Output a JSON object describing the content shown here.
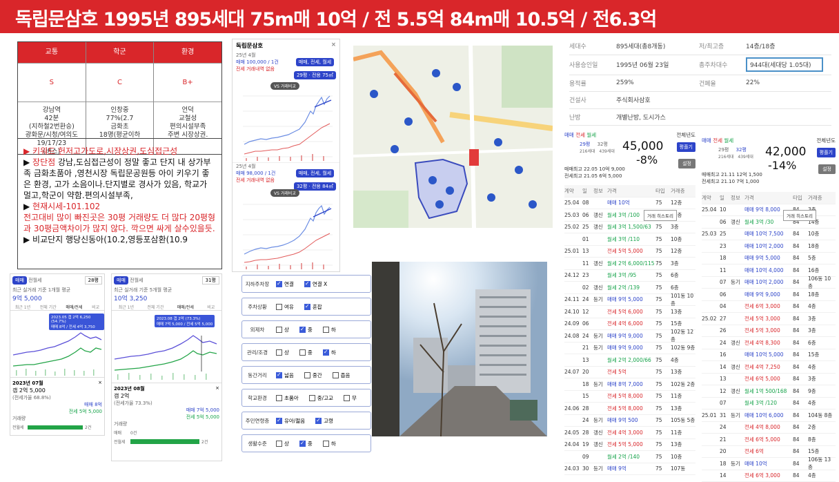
{
  "banner": {
    "title": "독립문삼호 1995년 895세대 75m매 10억 / 전 5.5억 84m매 10.5억 / 전6.3억"
  },
  "grade": {
    "headers": [
      "교통",
      "학군",
      "환경"
    ],
    "levels": [
      "S",
      "C",
      "B+"
    ],
    "details": [
      "강남역\n42분\n(지하철2번환승)\n광화문/시청/여의도\n19/17/23\n(버스)",
      "인창중\n77%(2.7\n금화초\n18명(평균이하",
      "언덕\n교철성\n편의시설부족\n주변 시장상권."
    ]
  },
  "note": {
    "l1": "▶ 키워드 헌저고가도로,시장상권,도심접근성",
    "l2a": "▶ ",
    "l2b": "장단점",
    "l2c": " 강남,도심접근성이 정말 좋고 단지 내 상가부족 금화초품아 ,영천시장 독립문공원등 아이 키우기 좋은 환경, 고가 소음이나.단지별로 경사가 있음, 학교가 멀고,학군이 약함.편의시설부족,",
    "l3a": "▶ ",
    "l3b": "현재시세-101.102",
    "l4": "전고대비 많이 빠진곳은 30평 거래량도 더 많다 20평형과 30평금액차이가 많지 않다. 깍으면 싸게 살수있을듯.",
    "l5": "▶ 비교단지 행당신동아(10.2,영등포삼환(10.9"
  },
  "chartcard": {
    "title": "독립문삼호",
    "close": "×",
    "top": {
      "date": "25년 4월",
      "price": "매매 100,000 / 1건",
      "sub": "전세 거래내역 없음",
      "chip": "매매, 전세, 월세",
      "chip2": "29평 · 전용 75㎡",
      "vs": "VS 거래비교"
    },
    "bottom": {
      "date": "25년 4월",
      "price": "매매 98,000 / 1건",
      "sub": "전세 거래내역 없음",
      "chip": "매매, 전세, 월세",
      "chip2": "32평 · 전용 84㎡",
      "vs": "VS 거래비교"
    },
    "yticks_top": [
      "16억",
      "14",
      "12",
      "10",
      "8",
      "6",
      "4",
      "2"
    ],
    "yticks_bottom": [
      "16억",
      "14",
      "12",
      "10",
      "8",
      "6",
      "4",
      "2"
    ]
  },
  "leftcard": {
    "tab1": "매매",
    "tab2": "전월세",
    "area": "28평",
    "cap": "최근 실거래 기준 1개월 평균",
    "price": "9억 5,000",
    "tabs": [
      "최근 1년",
      "전체 기간",
      "매매/전세",
      "비교"
    ],
    "tooltip1": "2023.05 갭 2억 6,250 (54.7%)",
    "tooltip2": "매매 8억 / 전세 4억 3,750",
    "popup_date": "2023년 07월",
    "gap": "갭 2억 5,000",
    "rate": "(전세가율 68.8%)",
    "sale": "매매 8억",
    "jeonse": "전세 5억 5,000",
    "trade_vol": "거래량",
    "vol_label": "전월세",
    "vol_val": "2건",
    "years": [
      "2008",
      "2009",
      "2010",
      "2012",
      "2014",
      "2016",
      "2018",
      "2020",
      "2022",
      "2024"
    ]
  },
  "midcard": {
    "tab1": "매매",
    "tab2": "전월세",
    "area": "31평",
    "cap": "최근 실거래 기준 5개월 평균",
    "price": "10억 3,250",
    "tabs": [
      "최근 1년",
      "전체 기간",
      "매매/전세",
      "비교"
    ],
    "tooltip1": "2023.08 갭 2억 (73.3%)",
    "tooltip2": "매매 7억 5,000 / 전세 5억 5,000",
    "popup_date": "2023년 08월",
    "gap": "갭 2억",
    "rate": "(전세가율 73.3%)",
    "sale": "매매 7억 5,000",
    "jeonse": "전세 5억 5,000",
    "trade_vol": "거래량",
    "row1": "매매",
    "row1_val": "0건",
    "row2": "전월세",
    "row2_val": "2건"
  },
  "checklist": {
    "rows": [
      {
        "label": "지하주차장",
        "options": [
          [
            "연결",
            true
          ],
          [
            "연결 X",
            true
          ]
        ]
      },
      {
        "label": "주차상황",
        "options": [
          [
            "여유",
            false
          ],
          [
            "혼잡",
            true
          ]
        ]
      },
      {
        "label": "외제차",
        "options": [
          [
            "상",
            false
          ],
          [
            "중",
            true
          ],
          [
            "하",
            false
          ]
        ]
      },
      {
        "label": "관리/조경",
        "options": [
          [
            "상",
            false
          ],
          [
            "중",
            false
          ],
          [
            "하",
            true
          ]
        ]
      },
      {
        "label": "동간거리",
        "options": [
          [
            "넓음",
            true
          ],
          [
            "중간",
            false
          ],
          [
            "좁음",
            false
          ]
        ]
      },
      {
        "label": "학교환경",
        "options": [
          [
            "초품아",
            false
          ],
          [
            "중/고교",
            false
          ],
          [
            "무",
            false
          ]
        ]
      },
      {
        "label": "주민연령층",
        "options": [
          [
            "유아/젊음",
            true
          ],
          [
            "고령",
            true
          ]
        ]
      },
      {
        "label": "생활수준",
        "options": [
          [
            "상",
            false
          ],
          [
            "중",
            true
          ],
          [
            "하",
            false
          ]
        ]
      }
    ]
  },
  "info": {
    "rows": [
      [
        "세대수",
        "895세대(총8개동)",
        "저/최고층",
        "14층/18층"
      ],
      [
        "사용승인일",
        "1995년 06월 23일",
        "총주차대수",
        "944대(세대당 1.05대)"
      ],
      [
        "용적률",
        "259%",
        "건폐율",
        "22%"
      ],
      [
        "건설사",
        "주식회사삼호",
        "",
        ""
      ],
      [
        "난방",
        "개별난방, 도시가스",
        "",
        ""
      ]
    ]
  },
  "tradeL": {
    "tabs": [
      "매매",
      "전세",
      "월세"
    ],
    "sort": "전체년도",
    "pyeong": "29평",
    "units": "216세대",
    "pyeong2": "32평",
    "units2": "439세대",
    "big": "45,000",
    "pct": "-8%",
    "hi1": "매매최고 22.05 10억 9,000",
    "hi2": "전세최고 21.05 6억 5,000",
    "btn1": "평플기",
    "btn2": "설정",
    "heads": [
      "계약",
      "일",
      "정보",
      "가격",
      "타입",
      "거래층"
    ],
    "tip": "거래 히스토리",
    "rows": [
      [
        "25.04",
        "08",
        "",
        "매매 10억",
        "75",
        "12층"
      ],
      [
        "25.03",
        "06",
        "갱신",
        "월세 3억 /100",
        "75",
        "12층"
      ],
      [
        "25.02",
        "25",
        "갱신",
        "월세 3억 1,500/63",
        "75",
        "3층"
      ],
      [
        "",
        "01",
        "",
        "월세 3억 /110",
        "75",
        "10층"
      ],
      [
        "25.01",
        "13",
        "",
        "전세 5억 5,000",
        "75",
        "12층"
      ],
      [
        "",
        "11",
        "갱신",
        "월세 2억 6,000/115",
        "75",
        "3층"
      ],
      [
        "24.12",
        "23",
        "",
        "월세 3억 /95",
        "75",
        "6층"
      ],
      [
        "",
        "02",
        "갱신",
        "월세 2억 /139",
        "75",
        "6층"
      ],
      [
        "24.11",
        "24",
        "등기",
        "매매 9억 5,000",
        "75",
        "101동 10층"
      ],
      [
        "24.10",
        "12",
        "",
        "전세 5억 6,000",
        "75",
        "13층"
      ],
      [
        "24.09",
        "06",
        "",
        "전세 4억 6,000",
        "75",
        "15층"
      ],
      [
        "24.08",
        "24",
        "등기",
        "매매 9억 9,000",
        "75",
        "102동 12층"
      ],
      [
        "",
        "21",
        "등기",
        "매매 9억 9,000",
        "75",
        "102동 9층"
      ],
      [
        "",
        "13",
        "",
        "월세 2억 2,000/66",
        "75",
        "4층"
      ],
      [
        "24.07",
        "20",
        "",
        "전세 5억",
        "75",
        "13층"
      ],
      [
        "",
        "18",
        "등기",
        "매매 8억 7,000",
        "75",
        "102동 2층"
      ],
      [
        "",
        "15",
        "",
        "전세 5억 8,000",
        "75",
        "11층"
      ],
      [
        "24.06",
        "28",
        "",
        "전세 5억 8,000",
        "75",
        "13층"
      ],
      [
        "",
        "24",
        "등기",
        "매매 9억 500",
        "75",
        "105동 5층"
      ],
      [
        "24.05",
        "28",
        "갱신",
        "전세 4억 3,000",
        "75",
        "11층"
      ],
      [
        "24.04",
        "19",
        "갱신",
        "전세 5억 5,000",
        "75",
        "13층"
      ],
      [
        "",
        "09",
        "",
        "월세 2억 /140",
        "75",
        "10층"
      ],
      [
        "24.03",
        "30",
        "등기",
        "매매 9억",
        "75",
        "107동"
      ]
    ]
  },
  "tradeR": {
    "tabs": [
      "매매",
      "전세",
      "월세"
    ],
    "sort": "전체년도",
    "pyeong": "29평",
    "units": "216세대",
    "pyeong2": "32평",
    "units2": "439세대",
    "big": "42,000",
    "pct": "-14%",
    "hi1": "매매최고 21.11 12억 1,500",
    "hi2": "전세최고 21.10 7억 1,000",
    "btn1": "평플기",
    "btn2": "설정",
    "heads": [
      "계약",
      "일",
      "정보",
      "가격",
      "타입",
      "거래층"
    ],
    "tip": "거래 히스토리",
    "rows": [
      [
        "25.04",
        "10",
        "",
        "매매 9억 8,000",
        "84",
        "3층"
      ],
      [
        "",
        "06",
        "갱신",
        "월세 3억 /30",
        "84",
        "14층"
      ],
      [
        "25.03",
        "25",
        "",
        "매매 10억 7,500",
        "84",
        "10층"
      ],
      [
        "",
        "23",
        "",
        "매매 10억 2,000",
        "84",
        "18층"
      ],
      [
        "",
        "18",
        "",
        "매매 9억 5,000",
        "84",
        "5층"
      ],
      [
        "",
        "11",
        "",
        "매매 10억 4,000",
        "84",
        "16층"
      ],
      [
        "",
        "07",
        "등기",
        "매매 10억 2,000",
        "84",
        "106동 10층"
      ],
      [
        "",
        "06",
        "",
        "매매 9억 9,000",
        "84",
        "18층"
      ],
      [
        "",
        "04",
        "",
        "전세 6억 3,000",
        "84",
        "4층"
      ],
      [
        "25.02",
        "27",
        "",
        "전세 5억 3,000",
        "84",
        "3층"
      ],
      [
        "",
        "26",
        "",
        "전세 5억 3,000",
        "84",
        "3층"
      ],
      [
        "",
        "24",
        "갱신",
        "전세 4억 8,300",
        "84",
        "6층"
      ],
      [
        "",
        "16",
        "",
        "매매 10억 5,000",
        "84",
        "15층"
      ],
      [
        "",
        "14",
        "갱신",
        "전세 4억 7,250",
        "84",
        "4층"
      ],
      [
        "",
        "13",
        "",
        "전세 6억 5,000",
        "84",
        "3층"
      ],
      [
        "",
        "12",
        "갱신",
        "월세 1억 500/168",
        "84",
        "9층"
      ],
      [
        "",
        "07",
        "",
        "월세 3억 /120",
        "84",
        "4층"
      ],
      [
        "25.01",
        "31",
        "등기",
        "매매 10억 6,000",
        "84",
        "104동 8층"
      ],
      [
        "",
        "24",
        "",
        "전세 4억 8,000",
        "84",
        "2층"
      ],
      [
        "",
        "21",
        "",
        "전세 6억 5,000",
        "84",
        "8층"
      ],
      [
        "",
        "20",
        "",
        "전세 6억",
        "84",
        "15층"
      ],
      [
        "",
        "18",
        "등기",
        "매매 10억",
        "84",
        "106동 13층"
      ],
      [
        "",
        "14",
        "",
        "전세 6억 3,000",
        "84",
        "4층"
      ]
    ]
  },
  "colors": {
    "accent": "#d9262a",
    "blue": "#2d44c9",
    "green": "#16a34a"
  }
}
